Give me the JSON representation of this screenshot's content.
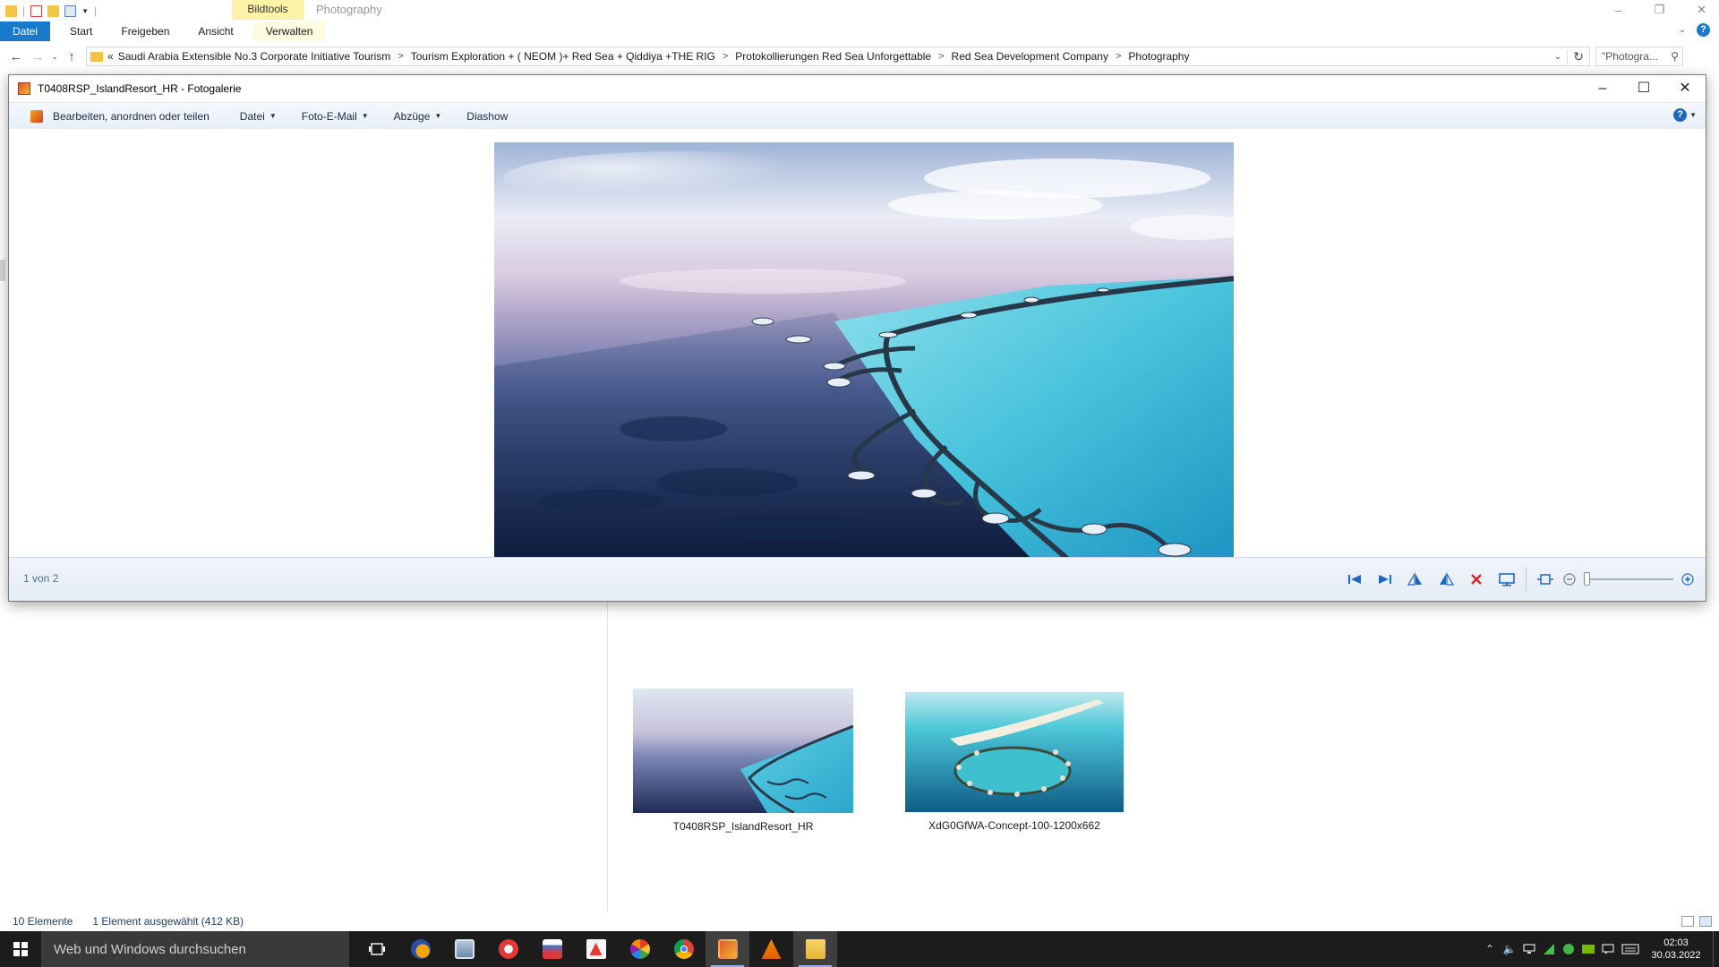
{
  "explorer": {
    "ribbon": {
      "context_group": "Bildtools",
      "context_title": "Photography",
      "tabs": [
        "Datei",
        "Start",
        "Freigeben",
        "Ansicht",
        "Verwalten"
      ]
    },
    "address": {
      "prefix": "«",
      "crumbs": [
        "Saudi Arabia Extensible No.3 Corporate Initiative Tourism",
        "Tourism Exploration + ( NEOM )+ Red Sea + Qiddiya +THE RIG",
        "Protokollierungen Red Sea Unforgettable",
        "Red Sea  Development Company",
        "Photography"
      ],
      "search_placeholder": "\"Photogra..."
    },
    "files": [
      {
        "name": "T0408RSP_IslandResort_HR"
      },
      {
        "name": "XdG0GfWA-Concept-100-1200x662"
      }
    ],
    "status": {
      "count": "10 Elemente",
      "selection": "1 Element ausgewählt (412 KB)"
    }
  },
  "gallery": {
    "title": "T0408RSP_IslandResort_HR - Fotogalerie",
    "menu": [
      "Bearbeiten, anordnen oder teilen",
      "Datei",
      "Foto-E-Mail",
      "Abzüge",
      "Diashow"
    ],
    "position": "1 von 2",
    "zoom_level": 0
  },
  "taskbar": {
    "search_placeholder": "Web und Windows durchsuchen",
    "time": "02:03",
    "date": "30.03.2022",
    "apps": [
      "task-view",
      "app-orange",
      "photo-viewer",
      "chrome-red",
      "image-app",
      "acrobat",
      "picasa",
      "chrome",
      "photo-gallery",
      "vlc",
      "file-explorer"
    ]
  }
}
